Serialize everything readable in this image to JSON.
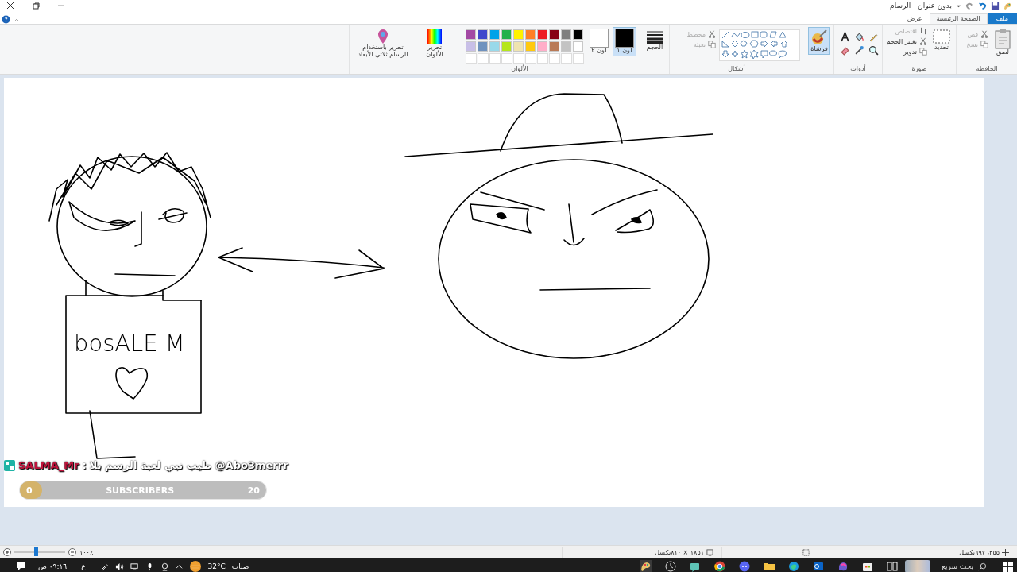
{
  "window": {
    "title": "بدون عنوان - الرسام"
  },
  "tabs": [
    {
      "label": "ملف",
      "kind": "file",
      "selected": false
    },
    {
      "label": "الصفحة الرئيسية",
      "kind": "tab",
      "selected": true
    },
    {
      "label": "عرض",
      "kind": "tab",
      "selected": false
    }
  ],
  "clipboard": {
    "label": "الحافظة",
    "paste": "لصق",
    "items": [
      {
        "label": "قص",
        "disabled": true
      },
      {
        "label": "نسخ",
        "disabled": true
      }
    ]
  },
  "image": {
    "label": "صورة",
    "select": "تحديد",
    "items": [
      {
        "label": "اقتصاص",
        "disabled": true
      },
      {
        "label": "تغيير الحجم",
        "disabled": false
      },
      {
        "label": "تدوير",
        "disabled": false
      }
    ]
  },
  "tools": {
    "label": "أدوات"
  },
  "brushes": {
    "label": "فرشاة",
    "selected": true
  },
  "shapes": {
    "label": "أشكال",
    "items": [
      {
        "label": "مخطط",
        "disabled": true
      },
      {
        "label": "تعبئة",
        "disabled": true
      }
    ]
  },
  "size": {
    "label": "الحجم"
  },
  "color1": {
    "label": "لون ١",
    "color": "#000000",
    "selected": true
  },
  "color2": {
    "label": "لون ٢",
    "color": "#ffffff",
    "selected": false
  },
  "colors": {
    "label": "الألوان",
    "palette": [
      {
        "color": "#a349a4"
      },
      {
        "color": "#3f48cc"
      },
      {
        "color": "#00a2e8"
      },
      {
        "color": "#22b14c"
      },
      {
        "color": "#fff200"
      },
      {
        "color": "#ff7f27"
      },
      {
        "color": "#ed1c24"
      },
      {
        "color": "#880015"
      },
      {
        "color": "#7f7f7f"
      },
      {
        "color": "#000000"
      },
      {
        "color": "#c8bfe7"
      },
      {
        "color": "#7092be"
      },
      {
        "color": "#99d9ea"
      },
      {
        "color": "#b5e61d"
      },
      {
        "color": "#efe4b0"
      },
      {
        "color": "#ffc90e"
      },
      {
        "color": "#ffaec9"
      },
      {
        "color": "#b97a57"
      },
      {
        "color": "#c3c3c3"
      },
      {
        "color": "#ffffff"
      }
    ]
  },
  "edit_colors": {
    "label": "تحرير الألوان"
  },
  "paint3d": {
    "label": "تحرير باستخدام الرسام ثلاثي الأبعاد"
  },
  "canvas": {
    "handwriting": "bosALE M"
  },
  "overlay": {
    "chat": {
      "user": "SALMA_Mr",
      "separator": ":",
      "message": "طيب نبي لعبة الرسم بلا @Abo3merrr"
    },
    "subscribers": {
      "current": "0",
      "label": "SUBSCRIBERS",
      "goal": "20",
      "level": 0
    }
  },
  "status_bar": {
    "cursor": "٣٥٥، ٦٩٧بكسل",
    "dimensions": "١٨٥١ × ٨١٠بكسل",
    "zoom": "١٠٠٪",
    "zoom_slider": {
      "level": 0.42
    }
  },
  "taskbar": {
    "search": "بحث سريع",
    "temperature": "32°C",
    "weather": "ضباب",
    "language": "ع",
    "time": "٠٩:١٦ ص"
  }
}
